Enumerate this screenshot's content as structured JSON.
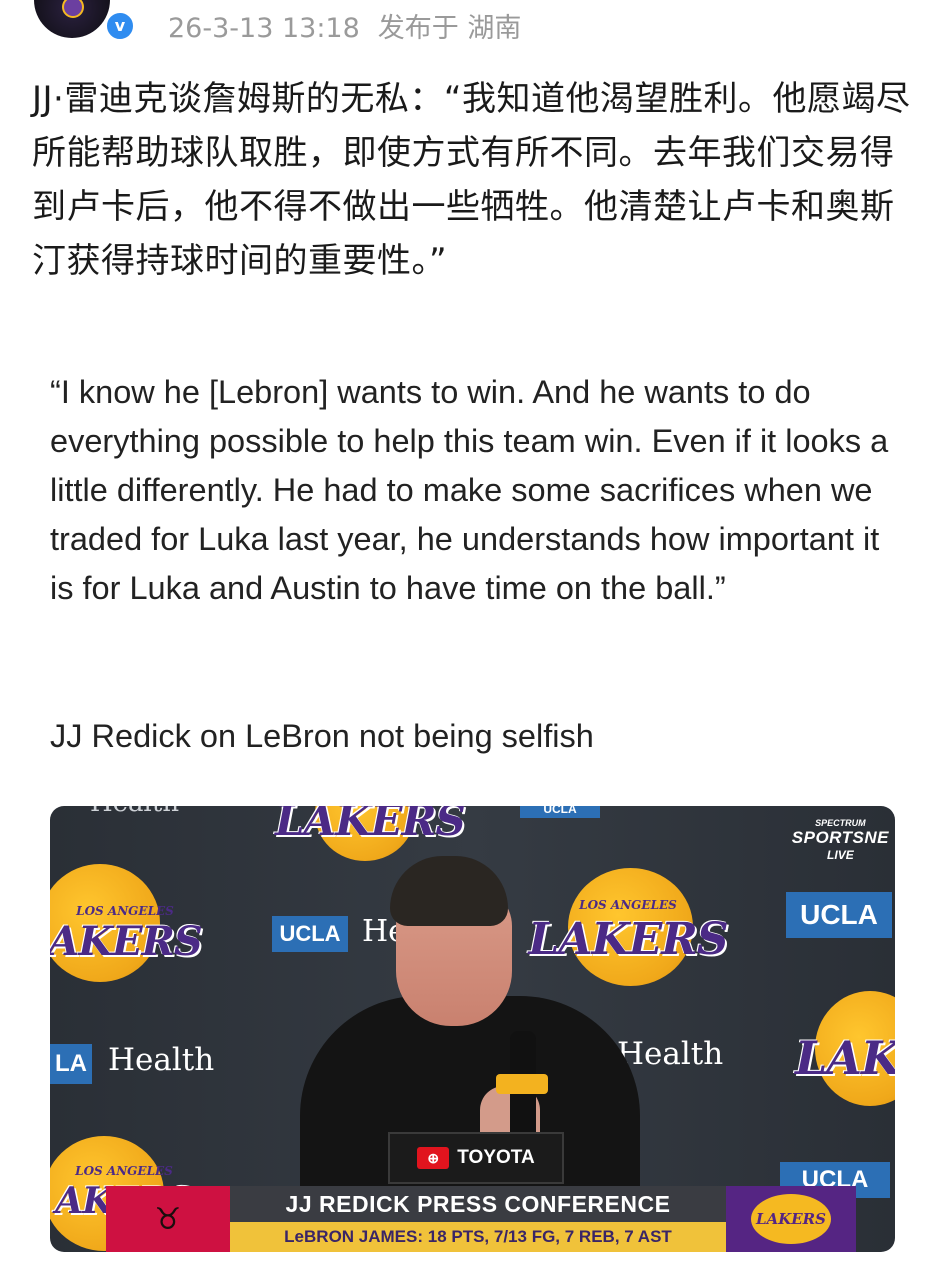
{
  "header": {
    "timestamp": "26-3-13 13:18",
    "location": "发布于 湖南",
    "verified_mark": "v"
  },
  "post": {
    "text_zh": "JJ·雷迪克谈詹姆斯的无私：“我知道他渴望胜利。他愿竭尽所能帮助球队取胜，即使方式有所不同。去年我们交易得到卢卡后，他不得不做出一些牺牲。他清楚让卢卡和奥斯汀获得持球时间的重要性。”",
    "quote_en": "“I know he [Lebron] wants to win. And he wants to do everything possible to help this team win. Even if it looks a little differently. He had to make some sacrifices when we traded for Luka last year, he understands how important it is for Luka and Austin to have time on the ball.”",
    "caption_en": "JJ Redick on LeBron not being selfish"
  },
  "image": {
    "backdrop": {
      "lakers_word": "LAKERS",
      "lakers_small": "LOS ANGELES",
      "lakers_partial": "AKERS",
      "ucla": "UCLA",
      "ucla_partial": "LA",
      "health": "Health",
      "he_partial": "He",
      "top_partial": "Health"
    },
    "network": {
      "line1": "SPECTRUM",
      "line2": "SPORTSNE",
      "line3": "LIVE"
    },
    "podium_sponsor": "TOYOTA",
    "lower_third": {
      "title": "JJ REDICK PRESS CONFERENCE",
      "stat_line": "LeBRON JAMES: 18 PTS, 7/13 FG, 7 REB, 7 AST",
      "right_logo": "LAKERS"
    }
  },
  "colors": {
    "lakers_purple": "#552583",
    "lakers_gold": "#f5b921",
    "bulls_red": "#ce1141",
    "ucla_blue": "#2c6fb5",
    "verified_blue": "#2f8cf0"
  },
  "icons": {
    "verified": "verified-badge-icon",
    "toyota": "toyota-logo-icon",
    "bulls": "bulls-logo-icon"
  }
}
